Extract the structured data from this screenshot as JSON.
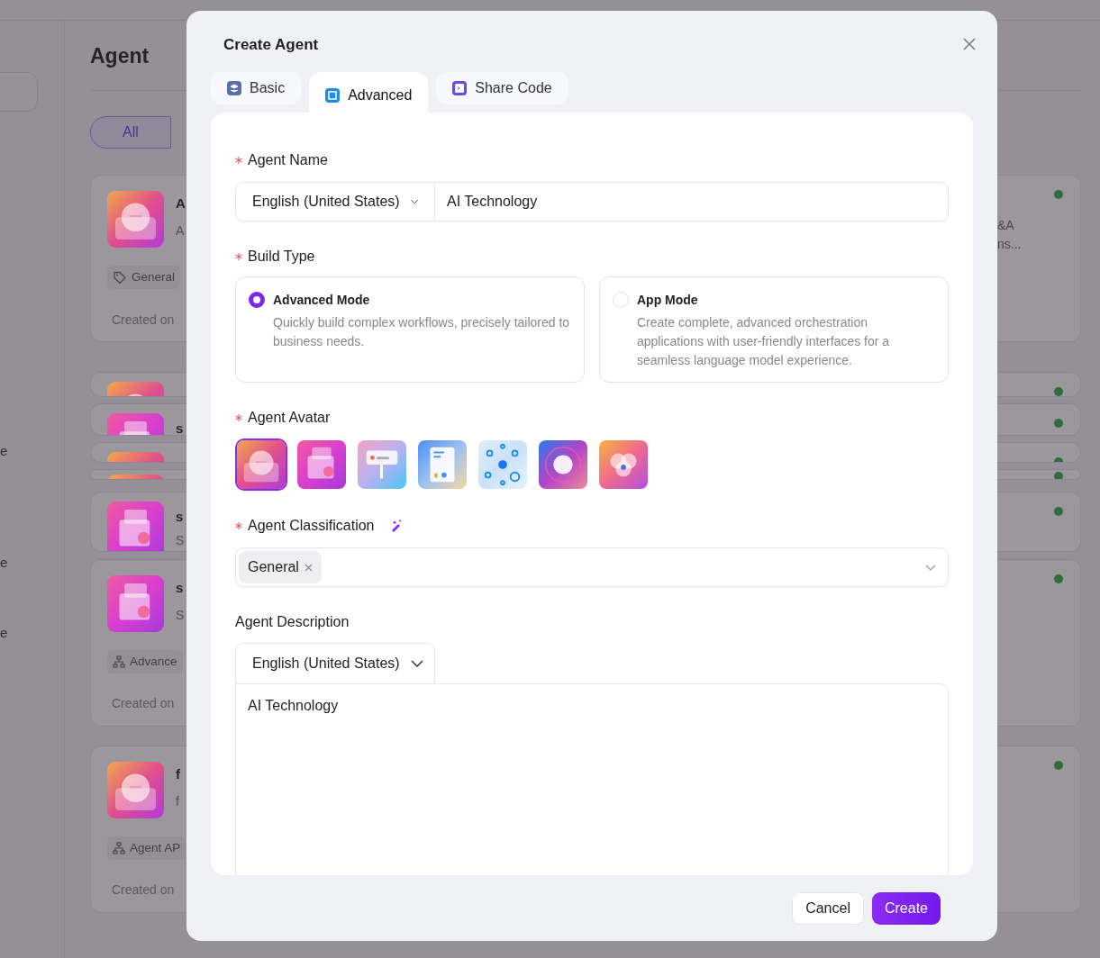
{
  "background": {
    "sidebar_items": [
      {
        "label": "e"
      },
      {
        "label": "e"
      },
      {
        "label": "e"
      }
    ],
    "page_title": "Agent",
    "filters": [
      {
        "label": "All",
        "selected": true
      }
    ],
    "cards": [
      {
        "kind": "full",
        "avatar": {
          "kind": "chat"
        },
        "title": "A",
        "description": "A",
        "tag": {
          "kind": "tag",
          "label": "General"
        },
        "created": "Created on",
        "side_lines": [
          "&A",
          "ns..."
        ]
      },
      {
        "kind": "strip",
        "avatar": {
          "kind": "chat"
        }
      },
      {
        "kind": "strip",
        "avatar": {
          "kind": "faq"
        },
        "title": "s"
      },
      {
        "kind": "strip",
        "avatar": {
          "kind": "chat"
        }
      },
      {
        "kind": "strip",
        "avatar": {
          "kind": "chat"
        }
      },
      {
        "kind": "short",
        "avatar": {
          "kind": "faq"
        },
        "title": "s",
        "description": "S"
      },
      {
        "kind": "full",
        "avatar": {
          "kind": "faq"
        },
        "title": "s",
        "description": "S",
        "tag": {
          "kind": "hierarchy",
          "label": "Advance"
        },
        "created": "Created on"
      },
      {
        "kind": "full",
        "avatar": {
          "kind": "chat"
        },
        "title": "f",
        "description": "f",
        "tag": {
          "kind": "hierarchy",
          "label": "Agent AP"
        },
        "created": "Created on"
      }
    ]
  },
  "dialog": {
    "title": "Create Agent",
    "tabs": [
      {
        "label": "Basic",
        "kind": "layers",
        "selected": false
      },
      {
        "label": "Advanced",
        "kind": "frame",
        "selected": true
      },
      {
        "label": "Share Code",
        "kind": "code",
        "selected": false
      }
    ],
    "agent_name": {
      "label": "Agent Name",
      "required": true,
      "language": "English (United States)",
      "value": "AI Technology"
    },
    "build_type": {
      "label": "Build Type",
      "required": true,
      "options": [
        {
          "title": "Advanced Mode",
          "description": "Quickly build complex workflows, precisely tailored to business needs.",
          "selected": true
        },
        {
          "title": "App Mode",
          "description": "Create complete, advanced orchestration applications with user-friendly interfaces for a seamless language model experience.",
          "selected": false
        }
      ]
    },
    "avatar": {
      "label": "Agent Avatar",
      "required": true,
      "options": [
        {
          "kind": "chat",
          "selected": true
        },
        {
          "kind": "faq",
          "selected": false
        },
        {
          "kind": "board",
          "selected": false
        },
        {
          "kind": "document",
          "selected": false
        },
        {
          "kind": "network",
          "selected": false
        },
        {
          "kind": "orb",
          "selected": false
        },
        {
          "kind": "bubbles",
          "selected": false
        }
      ]
    },
    "classification": {
      "label": "Agent Classification",
      "required": true,
      "tags": [
        {
          "label": "General"
        }
      ]
    },
    "description": {
      "label": "Agent Description",
      "required": false,
      "language": "English (United States)",
      "value": "AI Technology"
    },
    "buttons": [
      {
        "label": "Cancel",
        "kind": "secondary"
      },
      {
        "label": "Create",
        "kind": "primary"
      }
    ]
  }
}
